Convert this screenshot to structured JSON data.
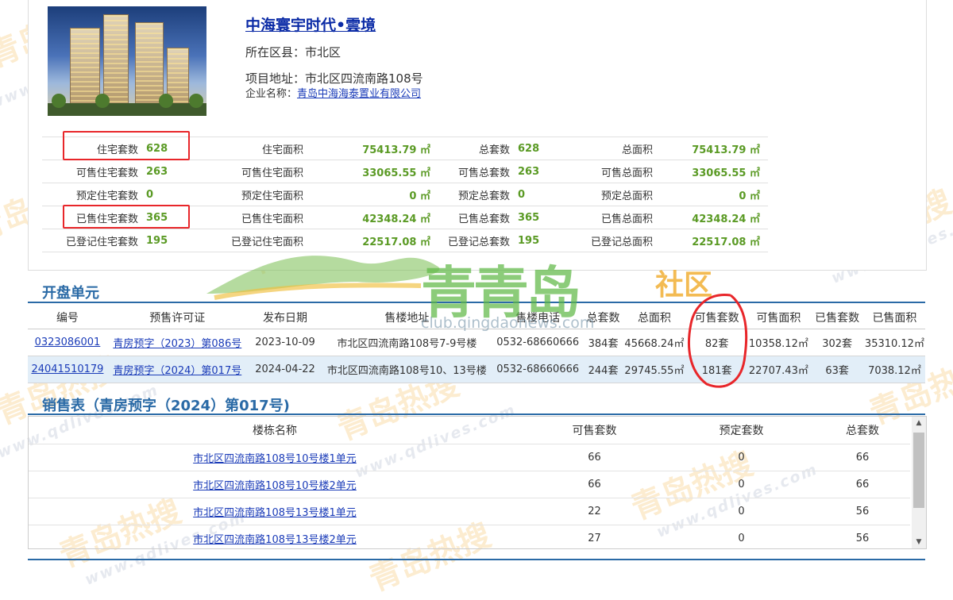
{
  "project": {
    "title": "中海寰宇时代•雲境",
    "district_label": "所在区县：",
    "district": "市北区",
    "address_label": "项目地址：",
    "address": "市北区四流南路108号",
    "company_label": "企业名称：",
    "company": "青岛中海海泰置业有限公司"
  },
  "stats": [
    [
      [
        "住宅套数",
        "628"
      ],
      [
        "住宅面积",
        "75413.79 ㎡"
      ],
      [
        "总套数",
        "628"
      ],
      [
        "总面积",
        "75413.79 ㎡"
      ]
    ],
    [
      [
        "可售住宅套数",
        "263"
      ],
      [
        "可售住宅面积",
        "33065.55 ㎡"
      ],
      [
        "可售总套数",
        "263"
      ],
      [
        "可售总面积",
        "33065.55 ㎡"
      ]
    ],
    [
      [
        "预定住宅套数",
        "0"
      ],
      [
        "预定住宅面积",
        "0 ㎡"
      ],
      [
        "预定总套数",
        "0"
      ],
      [
        "预定总面积",
        "0 ㎡"
      ]
    ],
    [
      [
        "已售住宅套数",
        "365"
      ],
      [
        "已售住宅面积",
        "42348.24 ㎡"
      ],
      [
        "已售总套数",
        "365"
      ],
      [
        "已售总面积",
        "42348.24 ㎡"
      ]
    ],
    [
      [
        "已登记住宅套数",
        "195"
      ],
      [
        "已登记住宅面积",
        "22517.08 ㎡"
      ],
      [
        "已登记总套数",
        "195"
      ],
      [
        "已登记总面积",
        "22517.08 ㎡"
      ]
    ]
  ],
  "units_section": {
    "title": "开盘单元",
    "headers": [
      "编号",
      "预售许可证",
      "发布日期",
      "售楼地址",
      "售楼电话",
      "总套数",
      "总面积",
      "可售套数",
      "可售面积",
      "已售套数",
      "已售面积"
    ],
    "rows": [
      [
        "0323086001",
        "青房预字（2023）第086号",
        "2023-10-09",
        "市北区四流南路108号7-9号楼",
        "0532-68660666",
        "384套",
        "45668.24㎡",
        "82套",
        "10358.12㎡",
        "302套",
        "35310.12㎡"
      ],
      [
        "24041510179",
        "青房预字（2024）第017号",
        "2024-04-22",
        "市北区四流南路108号10、13号楼",
        "0532-68660666",
        "244套",
        "29745.55㎡",
        "181套",
        "22707.43㎡",
        "63套",
        "7038.12㎡"
      ]
    ]
  },
  "sales_section": {
    "title": "销售表（青房预字（2024）第017号)",
    "headers": [
      "楼栋名称",
      "可售套数",
      "预定套数",
      "总套数"
    ],
    "rows": [
      [
        "市北区四流南路108号10号楼1单元",
        "66",
        "0",
        "66"
      ],
      [
        "市北区四流南路108号10号楼2单元",
        "66",
        "0",
        "66"
      ],
      [
        "市北区四流南路108号13号楼1单元",
        "22",
        "0",
        "56"
      ],
      [
        "市北区四流南路108号13号楼2单元",
        "27",
        "0",
        "56"
      ]
    ]
  },
  "watermarks": {
    "brand": "青岛热搜",
    "url": "www.qdlives.com",
    "club_name": "青青岛",
    "club_suffix": "社区",
    "club_url": "club.qingdaonews.com"
  },
  "colors": {
    "link": "#1a3bb8",
    "value_green": "#5a9a24",
    "section_blue": "#2a6aa6",
    "highlight_red": "#e8262a"
  }
}
